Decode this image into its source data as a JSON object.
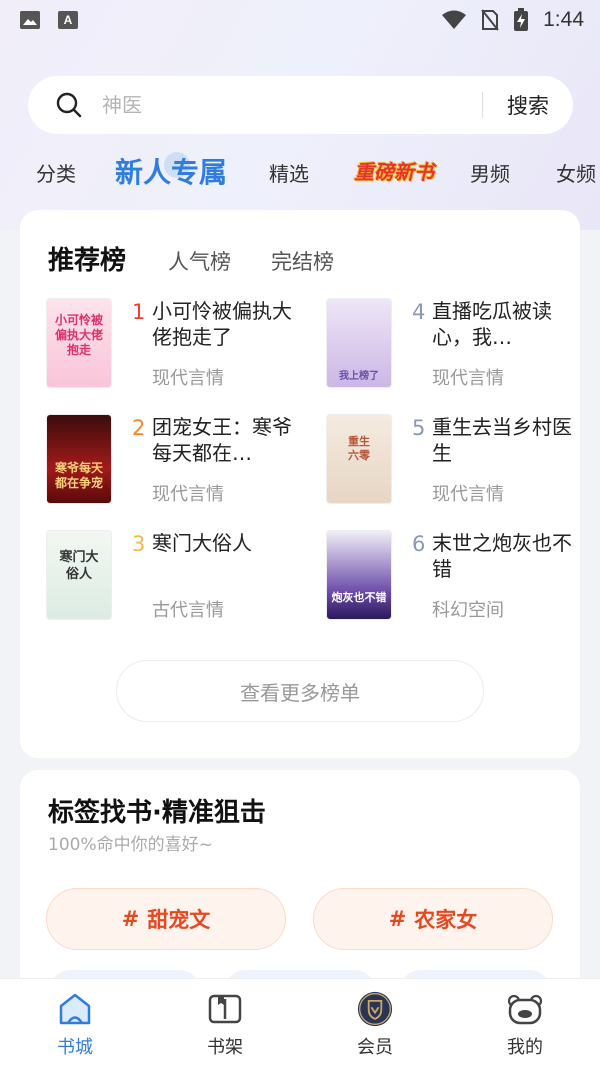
{
  "status_bar": {
    "time": "1:44",
    "app_letter": "A"
  },
  "search": {
    "placeholder": "神医",
    "button_label": "搜索"
  },
  "channel_tabs": [
    {
      "label": "分类"
    },
    {
      "label": "新人专属"
    },
    {
      "label": "精选"
    },
    {
      "label": "重磅新书"
    },
    {
      "label": "男频"
    },
    {
      "label": "女频"
    }
  ],
  "rank": {
    "tabs": [
      "推荐榜",
      "人气榜",
      "完结榜"
    ],
    "books": [
      {
        "rank": "1",
        "title": "小可怜被偏执大佬抱走了",
        "category": "现代言情",
        "cover_text": "小可怜被偏执大佬抱走",
        "rank_color": "#e8452c"
      },
      {
        "rank": "2",
        "title": "团宠女王：寒爷每天都在…",
        "category": "现代言情",
        "cover_text": "寒爷每天都在争宠",
        "rank_color": "#f08a24"
      },
      {
        "rank": "3",
        "title": "寒门大俗人",
        "category": "古代言情",
        "cover_text": "寒门大俗人",
        "rank_color": "#f3b94a"
      },
      {
        "rank": "4",
        "title": "直播吃瓜被读心，我…",
        "category": "现代言情",
        "cover_text": "我上榜了",
        "rank_color": "#8a98b8"
      },
      {
        "rank": "5",
        "title": "重生去当乡村医生",
        "category": "现代言情",
        "cover_text": "重生六零",
        "rank_color": "#8a98b8"
      },
      {
        "rank": "6",
        "title": "末世之炮灰也不错",
        "category": "科幻空间",
        "cover_text": "炮灰也不错",
        "rank_color": "#8a98b8"
      }
    ],
    "more_label": "查看更多榜单"
  },
  "tag_section": {
    "title": "标签找书·精准狙击",
    "subtitle": "100%命中你的喜好~",
    "tags": [
      "甜宠文",
      "农家女"
    ],
    "hash": "#"
  },
  "bottom_nav": [
    {
      "label": "书城"
    },
    {
      "label": "书架"
    },
    {
      "label": "会员"
    },
    {
      "label": "我的"
    }
  ],
  "colors": {
    "accent": "#2f7de1",
    "tag": "#e8481f"
  }
}
